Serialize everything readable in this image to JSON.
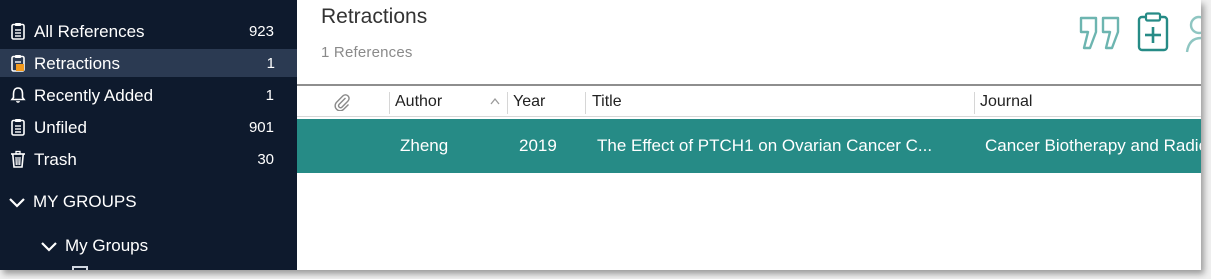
{
  "sidebar": {
    "items": [
      {
        "label": "All References",
        "count": "923",
        "icon": "clipboard-icon"
      },
      {
        "label": "Retractions",
        "count": "1",
        "icon": "retraction-clipboard-icon"
      },
      {
        "label": "Recently Added",
        "count": "1",
        "icon": "bell-icon"
      },
      {
        "label": "Unfiled",
        "count": "901",
        "icon": "clipboard-icon"
      },
      {
        "label": "Trash",
        "count": "30",
        "icon": "trash-icon"
      }
    ],
    "groups_header": "MY GROUPS",
    "groups_sub": "My Groups"
  },
  "main": {
    "title": "Retractions",
    "subtitle": "1 References",
    "columns": {
      "attachment": "",
      "author": "Author",
      "year": "Year",
      "title": "Title",
      "journal": "Journal"
    },
    "rows": [
      {
        "author": "Zheng",
        "year": "2019",
        "title": "The Effect of PTCH1 on Ovarian Cancer C...",
        "journal": "Cancer Biotherapy and Radiopharmaceuticals"
      }
    ]
  },
  "colors": {
    "sidebar_bg": "#0e1a2d",
    "sidebar_selected": "#2b3a52",
    "accent_teal": "#268b86",
    "retraction_orange": "#f29a1e"
  }
}
